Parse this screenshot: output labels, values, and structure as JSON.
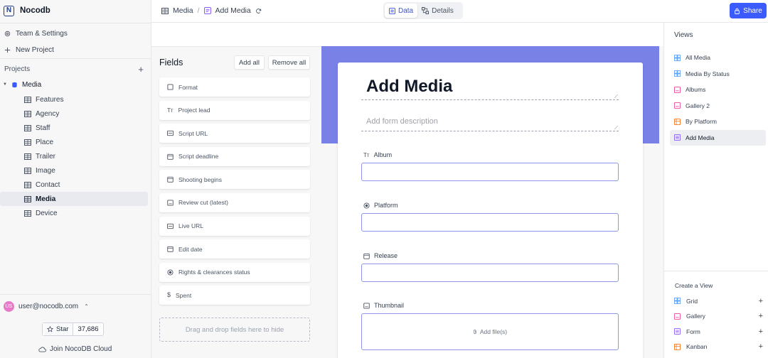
{
  "app": {
    "name": "Nocodb",
    "logo_letter": "N"
  },
  "sidebar": {
    "team_settings": "Team & Settings",
    "new_project": "New Project",
    "projects_label": "Projects",
    "project_name": "Media",
    "tables": [
      {
        "label": "Features"
      },
      {
        "label": "Agency"
      },
      {
        "label": "Staff"
      },
      {
        "label": "Place"
      },
      {
        "label": "Trailer"
      },
      {
        "label": "Image"
      },
      {
        "label": "Contact"
      },
      {
        "label": "Media",
        "active": true
      },
      {
        "label": "Device"
      }
    ],
    "user": {
      "initials": "US",
      "email": "user@nocodb.com"
    },
    "star": {
      "label": "Star",
      "count": "37,686"
    },
    "cloud_link": "Join NocoDB Cloud"
  },
  "topbar": {
    "breadcrumb_table": "Media",
    "breadcrumb_view": "Add Media",
    "tab_data": "Data",
    "tab_details": "Details",
    "share_label": "Share"
  },
  "fields_panel": {
    "title": "Fields",
    "add_all": "Add all",
    "remove_all": "Remove all",
    "fields": [
      {
        "label": "Format",
        "icon": "checkbox-icon"
      },
      {
        "label": "Project lead",
        "icon": "text-type-icon"
      },
      {
        "label": "Script URL",
        "icon": "link-icon"
      },
      {
        "label": "Script deadline",
        "icon": "calendar-icon"
      },
      {
        "label": "Shooting begins",
        "icon": "calendar-icon"
      },
      {
        "label": "Review cut (latest)",
        "icon": "attachment-icon"
      },
      {
        "label": "Live URL",
        "icon": "link-icon"
      },
      {
        "label": "Edit date",
        "icon": "calendar-icon"
      },
      {
        "label": "Rights & clearances status",
        "icon": "single-select-icon"
      },
      {
        "label": "Spent",
        "icon": "dollar-icon"
      }
    ],
    "drop_hint": "Drag and drop fields here to hide"
  },
  "form": {
    "title": "Add Media",
    "description_placeholder": "Add form description",
    "banner_color": "#7a81e6",
    "fields": [
      {
        "label": "Album",
        "icon": "text-type-icon"
      },
      {
        "label": "Platform",
        "icon": "single-select-icon"
      },
      {
        "label": "Release",
        "icon": "calendar-icon"
      },
      {
        "label": "Thumbnail",
        "icon": "attachment-icon",
        "upload_label": "Add file(s)"
      }
    ]
  },
  "views_panel": {
    "title": "Views",
    "views": [
      {
        "label": "All Media",
        "icon": "grid-icon",
        "color": "#60a5fa"
      },
      {
        "label": "Media By Status",
        "icon": "grid-icon",
        "color": "#60a5fa"
      },
      {
        "label": "Albums",
        "icon": "gallery-icon",
        "color": "#ec4899"
      },
      {
        "label": "Gallery 2",
        "icon": "gallery-icon",
        "color": "#ec4899"
      },
      {
        "label": "By Platform",
        "icon": "kanban-icon",
        "color": "#f97316"
      },
      {
        "label": "Add Media",
        "icon": "form-icon",
        "color": "#8b5cf6",
        "active": true
      }
    ],
    "create_title": "Create a View",
    "create_items": [
      {
        "label": "Grid",
        "icon": "grid-icon",
        "color": "#60a5fa"
      },
      {
        "label": "Gallery",
        "icon": "gallery-icon",
        "color": "#ec4899"
      },
      {
        "label": "Form",
        "icon": "form-icon",
        "color": "#8b5cf6"
      },
      {
        "label": "Kanban",
        "icon": "kanban-icon",
        "color": "#f97316"
      }
    ]
  },
  "colors": {
    "accent": "#3b5bfd",
    "active_tab": "#3b52d6"
  }
}
